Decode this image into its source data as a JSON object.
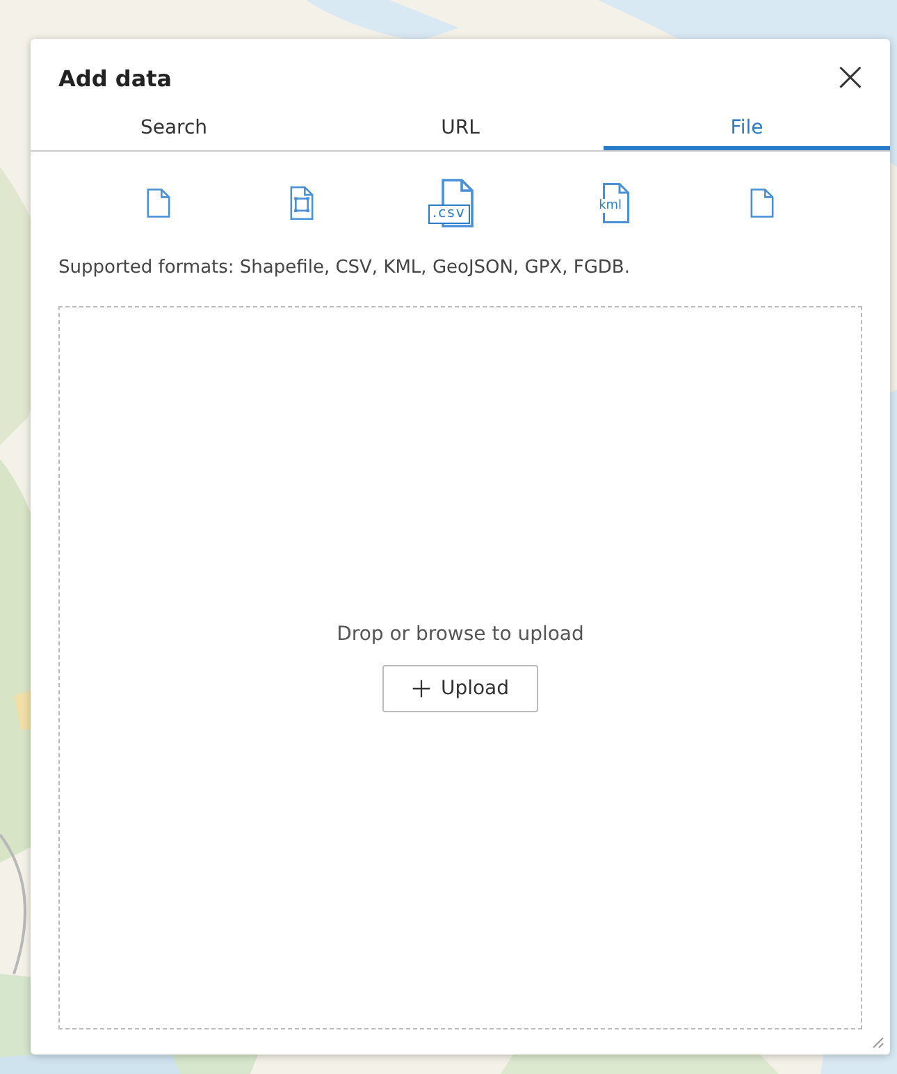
{
  "dialog": {
    "title": "Add data",
    "close_icon": "×"
  },
  "tabs": [
    {
      "label": "Search",
      "selected": false
    },
    {
      "label": "URL",
      "selected": false
    },
    {
      "label": "File",
      "selected": true
    }
  ],
  "formats": [
    {
      "kind": "blank",
      "selected": false
    },
    {
      "kind": "shape",
      "selected": false
    },
    {
      "kind": "labeled",
      "label": ".csv",
      "selected": true
    },
    {
      "kind": "labeled",
      "label": "kml",
      "selected": false
    },
    {
      "kind": "blank",
      "selected": false
    }
  ],
  "supported_text": "Supported formats: Shapefile, CSV, KML, GeoJSON, GPX, FGDB.",
  "dropzone": {
    "text": "Drop or browse to upload",
    "button": "Upload"
  }
}
